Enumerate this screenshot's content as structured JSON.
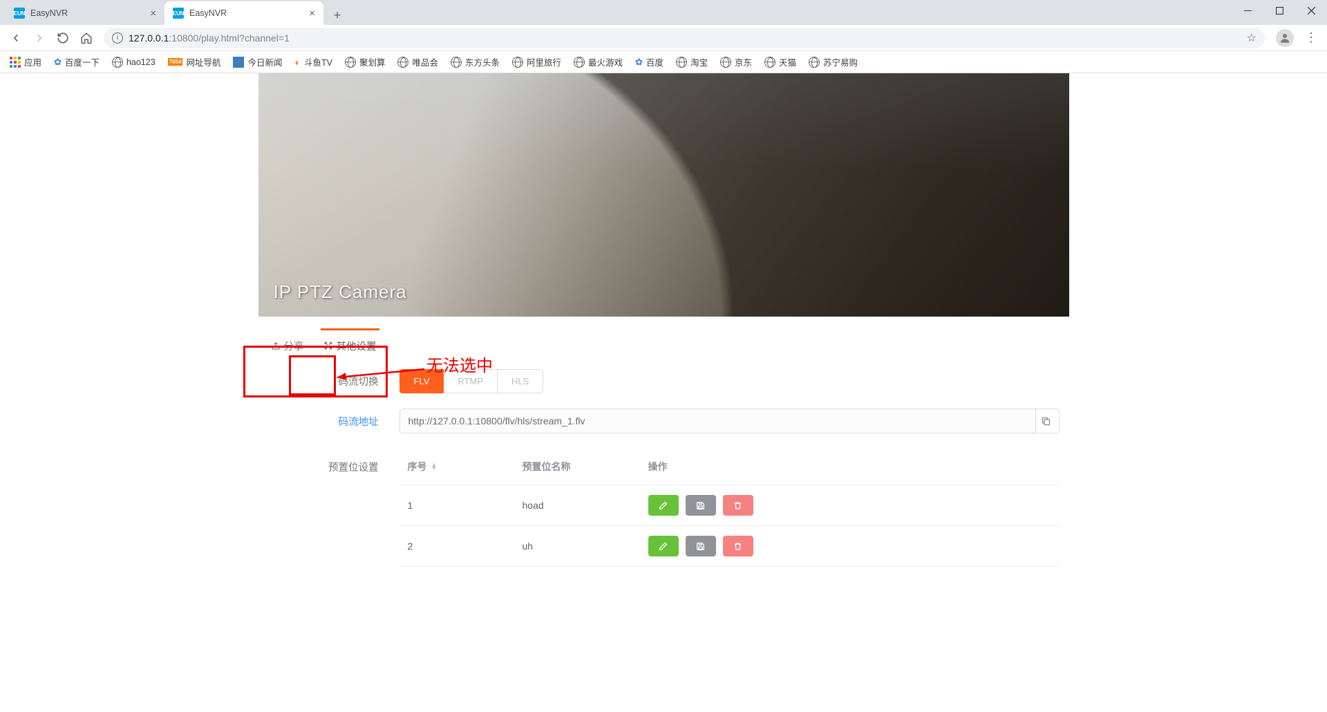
{
  "window": {
    "minimize": "—",
    "maximize": "◻",
    "close": "✕"
  },
  "tabs": [
    {
      "title": "EasyNVR",
      "active": false
    },
    {
      "title": "EasyNVR",
      "active": true
    }
  ],
  "url": {
    "host": "127.0.0.1",
    "port_path": ":10800/play.html?channel=1"
  },
  "bookmarks": {
    "apps": "应用",
    "items": [
      "百度一下",
      "hao123",
      "网址导航",
      "今日新闻",
      "斗鱼TV",
      "聚划算",
      "唯品会",
      "东方头条",
      "阿里旅行",
      "最火游戏",
      "百度",
      "淘宝",
      "京东",
      "天猫",
      "苏宁易购"
    ]
  },
  "video": {
    "label": "IP PTZ Camera"
  },
  "panel": {
    "share_tab": "分享",
    "settings_tab": "其他设置",
    "stream_switch_label": "码流切换",
    "stream_opts": {
      "flv": "FLV",
      "rtmp": "RTMP",
      "hls": "HLS"
    },
    "stream_url_label": "码流地址",
    "stream_url": "http://127.0.0.1:10800/flv/hls/stream_1.flv",
    "preset_label": "预置位设置",
    "table": {
      "col_no": "序号",
      "col_name": "预置位名称",
      "col_act": "操作",
      "rows": [
        {
          "no": "1",
          "name": "hoad"
        },
        {
          "no": "2",
          "name": "uh"
        }
      ]
    }
  },
  "annotation": {
    "text": "无法选中"
  }
}
